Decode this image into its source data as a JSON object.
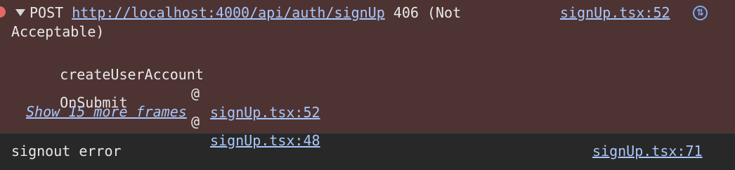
{
  "error": {
    "method": "POST",
    "url": "http://localhost:4000/api/auth/signUp",
    "status_text": "406 (Not Acceptable)",
    "source_link": "signUp.tsx:52",
    "network_icon": "network-request-icon",
    "frames": [
      {
        "function": "createUserAccount",
        "at": "@",
        "link": "signUp.tsx:52"
      },
      {
        "function": "OnSubmit",
        "at": "@",
        "link": "signUp.tsx:48"
      }
    ],
    "more_frames_label": "Show 15 more frames",
    "colors": {
      "background": "#4e3333",
      "link": "#a8c7fa",
      "error_dot": "#e46962"
    }
  },
  "log": {
    "message": "signout error",
    "source_link": "signUp.tsx:71",
    "background": "#282828"
  }
}
